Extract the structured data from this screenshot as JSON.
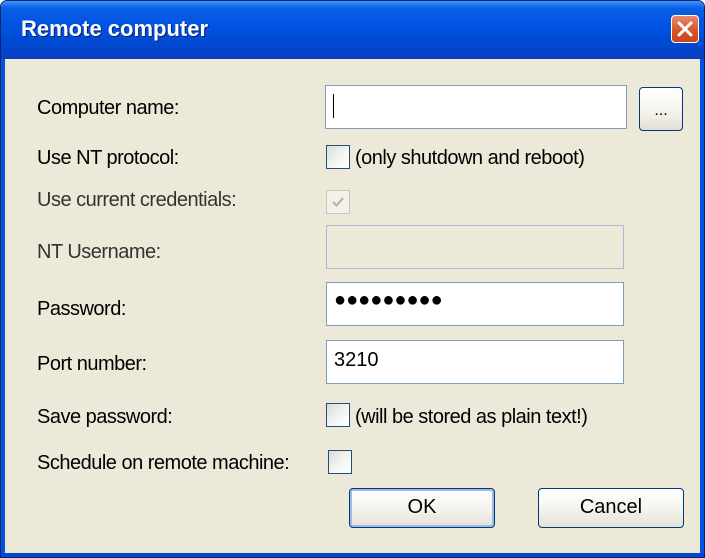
{
  "window": {
    "title": "Remote computer"
  },
  "fields": {
    "computer_name": {
      "label": "Computer name:",
      "value": ""
    },
    "browse_label": "...",
    "use_nt": {
      "label": "Use NT protocol:",
      "note": "(only shutdown and reboot)",
      "checked": false
    },
    "use_credentials": {
      "label": "Use current credentials:",
      "checked": true,
      "disabled": true
    },
    "nt_username": {
      "label": "NT Username:",
      "value": ""
    },
    "password": {
      "label": "Password:",
      "masked_value": "●●●●●●●●●"
    },
    "port": {
      "label": "Port number:",
      "value": "3210"
    },
    "save_password": {
      "label": "Save password:",
      "note": "(will be stored as plain text!)",
      "checked": false
    },
    "schedule": {
      "label": "Schedule on remote machine:",
      "checked": false
    }
  },
  "buttons": {
    "ok": "OK",
    "cancel": "Cancel"
  },
  "colors": {
    "titlebar": "#0054e3",
    "dialog_bg": "#ece9d8",
    "close": "#d6552b"
  }
}
